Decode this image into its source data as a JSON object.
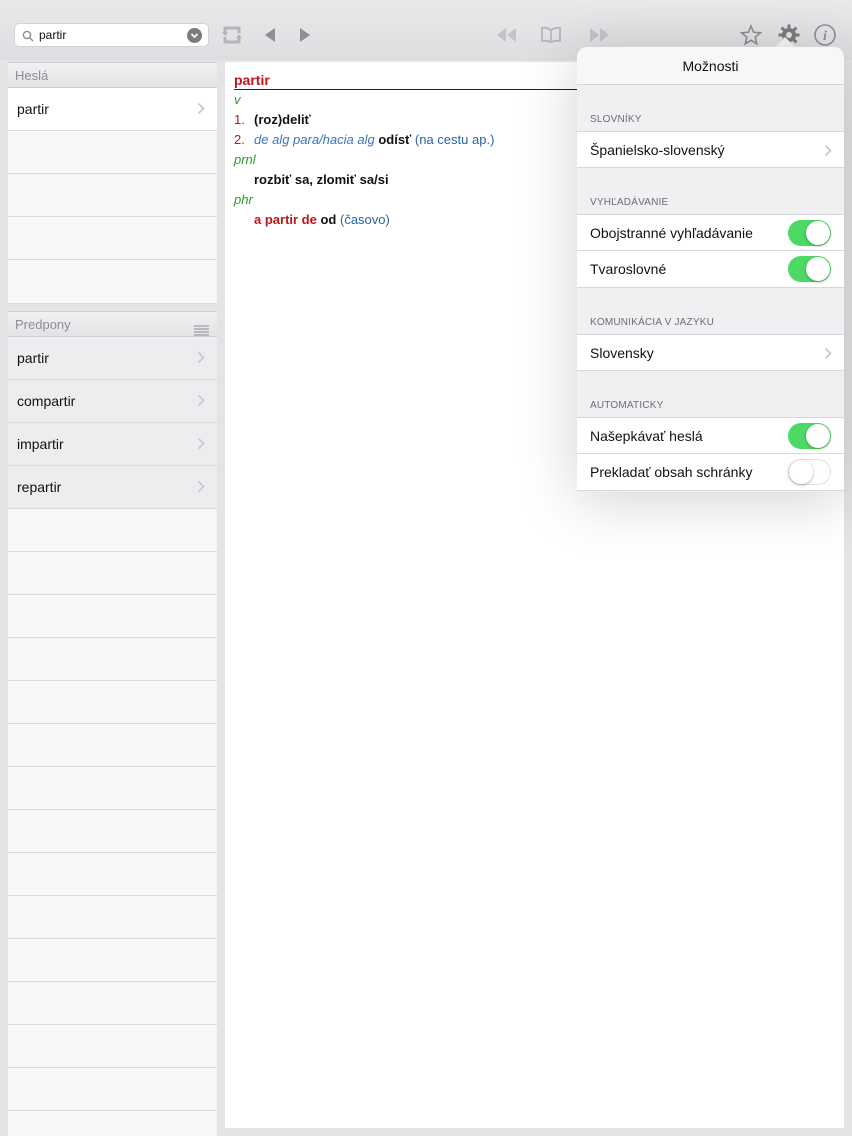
{
  "search": {
    "value": "partir"
  },
  "headwords": {
    "title": "Heslá",
    "items": [
      {
        "label": "partir"
      }
    ]
  },
  "prefixes": {
    "title": "Predpony",
    "items": [
      {
        "label": "partir"
      },
      {
        "label": "compartir"
      },
      {
        "label": "impartir"
      },
      {
        "label": "repartir"
      }
    ]
  },
  "entry": {
    "headword": "partir",
    "pos_v": "v",
    "sense1_num": "1.",
    "sense1_text": "(roz)deliť",
    "sense2_num": "2.",
    "sense2_italic": "de alg para/hacia alg",
    "sense2_bold": "odísť",
    "sense2_note": "(na cestu ap.)",
    "pos_prnl": "prnl",
    "prnl_text": "rozbiť sa, zlomiť sa/si",
    "pos_phr": "phr",
    "phr_red": "a partir de",
    "phr_bold": "od",
    "phr_note": "(časovo)"
  },
  "options": {
    "title": "Možnosti",
    "group_dictionaries": "SLOVNÍKY",
    "dictionary": "Španielsko-slovenský",
    "group_search": "VYHĽADÁVANIE",
    "bidirectional_search": {
      "label": "Obojstranné vyhľadávanie",
      "on": true
    },
    "morphological": {
      "label": "Tvaroslovné",
      "on": true
    },
    "group_language": "KOMUNIKÁCIA V JAZYKU",
    "language": "Slovensky",
    "group_auto": "AUTOMATICKY",
    "suggest": {
      "label": "Našepkávať heslá",
      "on": true
    },
    "clipboard": {
      "label": "Prekladať obsah schránky",
      "on": false
    }
  },
  "colors": {
    "accent_red": "#c0161b",
    "toggle_green": "#4cd964",
    "pos_green": "#2b9a2a",
    "note_blue": "#2b61a8"
  },
  "icons": {
    "toolbar": [
      "search-icon",
      "clear-icon",
      "refresh-icon",
      "back-icon",
      "forward-icon",
      "rewind-icon",
      "book-icon",
      "fast-forward-icon",
      "star-icon",
      "gear-icon",
      "info-icon"
    ]
  }
}
